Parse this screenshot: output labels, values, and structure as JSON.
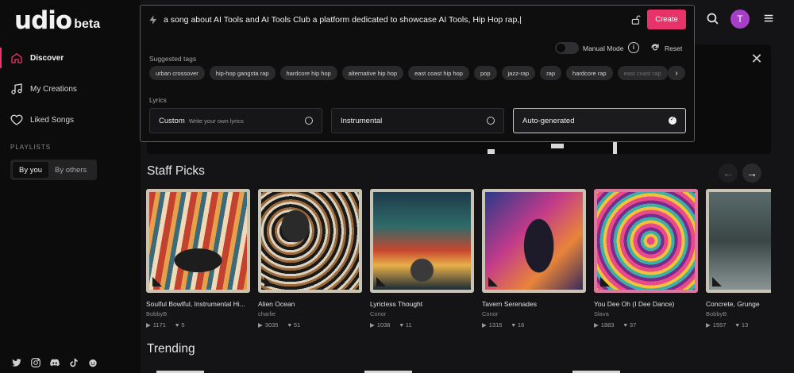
{
  "brand": {
    "name": "udio",
    "tag": "beta"
  },
  "nav": [
    {
      "label": "Discover",
      "icon": "home-icon",
      "active": true
    },
    {
      "label": "My Creations",
      "icon": "music-note-icon",
      "active": false
    },
    {
      "label": "Liked Songs",
      "icon": "heart-icon",
      "active": false
    }
  ],
  "playlists": {
    "label": "PLAYLISTS",
    "tabs": [
      "By you",
      "By others"
    ],
    "selected": "By you"
  },
  "socials": [
    "twitter-icon",
    "instagram-icon",
    "discord-icon",
    "tiktok-icon",
    "reddit-icon"
  ],
  "prompt": {
    "value": "a song about AI Tools and AI Tools Club a platform dedicated to showcase AI Tools, Hip Hop rap,|",
    "create_label": "Create",
    "manual_mode_label": "Manual Mode",
    "reset_label": "Reset",
    "suggested_label": "Suggested tags",
    "tags": [
      "urban crossover",
      "hip-hop gangsta rap",
      "hardcore hip hop",
      "alternative hip hop",
      "east coast hip hop",
      "pop",
      "jazz-rap",
      "rap",
      "hardcore rap",
      "east coast rap"
    ],
    "lyrics_label": "Lyrics",
    "lyrics_options": [
      {
        "name": "Custom",
        "sub": "Write your own lyrics",
        "selected": false
      },
      {
        "name": "Instrumental",
        "sub": "",
        "selected": false
      },
      {
        "name": "Auto-generated",
        "sub": "",
        "selected": true
      }
    ]
  },
  "header": {
    "avatar_letter": "T"
  },
  "staff_picks": {
    "title": "Staff Picks",
    "cards": [
      {
        "title": "Soulful Bowlful, Instrumental Hi...",
        "artist": "BobbyB",
        "plays": "1171",
        "likes": "5"
      },
      {
        "title": "Alien Ocean",
        "artist": "charlie",
        "plays": "3035",
        "likes": "51"
      },
      {
        "title": "Lyricless Thought",
        "artist": "Conor",
        "plays": "1038",
        "likes": "11"
      },
      {
        "title": "Tavern Serenades",
        "artist": "Conor",
        "plays": "1315",
        "likes": "16"
      },
      {
        "title": "You Dee Oh (I Dee Dance)",
        "artist": "Slava",
        "plays": "1883",
        "likes": "37"
      },
      {
        "title": "Concrete, Grunge",
        "artist": "BobbyB",
        "plays": "1557",
        "likes": "13"
      }
    ]
  },
  "trending": {
    "title": "Trending"
  },
  "colors": {
    "accent": "#e8336a",
    "avatar": "#a63fc8"
  }
}
